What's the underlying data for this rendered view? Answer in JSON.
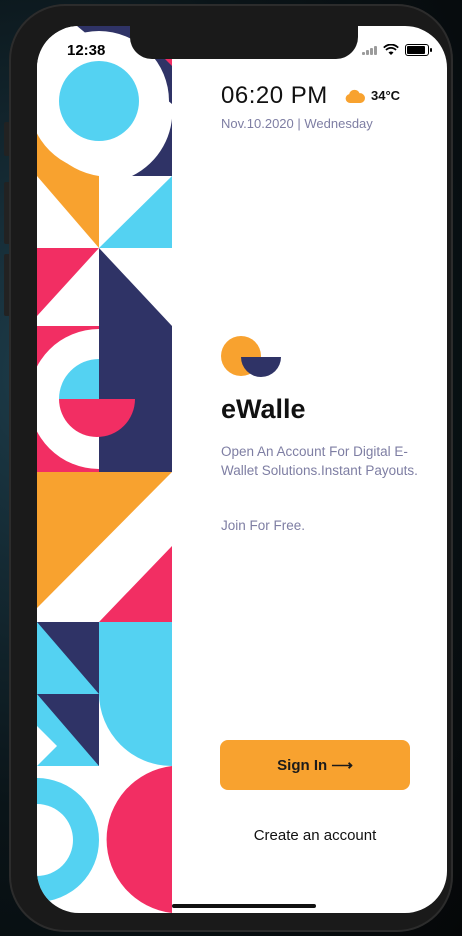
{
  "status_bar": {
    "time": "12:38"
  },
  "header": {
    "clock": "06:20 PM",
    "temperature": "34°C",
    "date": "Nov.10.2020 | Wednesday",
    "weather_icon": "cloud-icon"
  },
  "brand": {
    "name": "eWalle",
    "tagline": "Open An Account For Digital E-Wallet Solutions.Instant Payouts.",
    "join_text": "Join For Free."
  },
  "actions": {
    "sign_in_label": "Sign In",
    "sign_in_arrow": "⟶",
    "create_account_label": "Create an account"
  },
  "colors": {
    "orange": "#F8A22F",
    "navy": "#2F3366",
    "pink": "#F22E63",
    "cyan": "#54D2F2",
    "muted": "#7E7EA3"
  }
}
